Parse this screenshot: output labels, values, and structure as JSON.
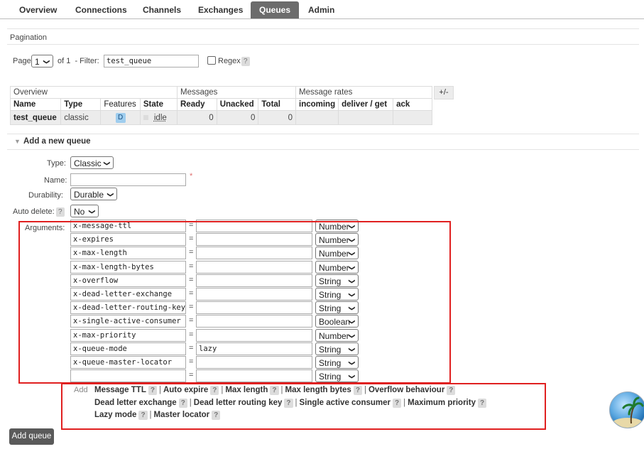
{
  "nav": {
    "tabs": [
      "Overview",
      "Connections",
      "Channels",
      "Exchanges",
      "Queues",
      "Admin"
    ],
    "active": "Queues"
  },
  "pagination": {
    "heading": "Pagination",
    "page_label": "Page",
    "page_value": "1",
    "of_label": "of 1  - Filter:",
    "filter_value": "test_queue",
    "regex_label": "Regex",
    "help": "?"
  },
  "queues_table": {
    "group_headers": [
      "Overview",
      "Messages",
      "Message rates"
    ],
    "plus_minus": "+/-",
    "columns": [
      "Name",
      "Type",
      "Features",
      "State",
      "Ready",
      "Unacked",
      "Total",
      "incoming",
      "deliver / get",
      "ack"
    ],
    "rows": [
      {
        "name": "test_queue",
        "type": "classic",
        "feature": "D",
        "state": "idle",
        "ready": "0",
        "unacked": "0",
        "total": "0",
        "incoming": "",
        "deliver_get": "",
        "ack": ""
      }
    ]
  },
  "add_queue": {
    "section_title": "Add a new queue",
    "type_label": "Type:",
    "type_value": "Classic",
    "name_label": "Name:",
    "name_required_marker": "*",
    "durability_label": "Durability:",
    "durability_value": "Durable",
    "auto_delete_label": "Auto delete:",
    "auto_delete_value": "No",
    "arguments_label": "Arguments:",
    "equals": "=",
    "arguments": [
      {
        "key": "x-message-ttl",
        "value": "",
        "type": "Number"
      },
      {
        "key": "x-expires",
        "value": "",
        "type": "Number"
      },
      {
        "key": "x-max-length",
        "value": "",
        "type": "Number"
      },
      {
        "key": "x-max-length-bytes",
        "value": "",
        "type": "Number"
      },
      {
        "key": "x-overflow",
        "value": "",
        "type": "String"
      },
      {
        "key": "x-dead-letter-exchange",
        "value": "",
        "type": "String"
      },
      {
        "key": "x-dead-letter-routing-key",
        "value": "",
        "type": "String"
      },
      {
        "key": "x-single-active-consumer",
        "value": "",
        "type": "Boolean"
      },
      {
        "key": "x-max-priority",
        "value": "",
        "type": "Number"
      },
      {
        "key": "x-queue-mode",
        "value": "lazy",
        "type": "String"
      },
      {
        "key": "x-queue-master-locator",
        "value": "",
        "type": "String"
      },
      {
        "key": "",
        "value": "",
        "type": "String"
      }
    ],
    "add_label": "Add",
    "add_links_row1": [
      "Message TTL",
      "Auto expire",
      "Max length",
      "Max length bytes",
      "Overflow behaviour"
    ],
    "add_links_row2": [
      "Dead letter exchange",
      "Dead letter routing key",
      "Single active consumer",
      "Maximum priority"
    ],
    "add_links_row3": [
      "Lazy mode",
      "Master locator"
    ],
    "submit_label": "Add queue"
  },
  "colors": {
    "active_tab": "#6c6c6c",
    "highlight_box": "#e02020",
    "button": "#5a5a5a"
  }
}
